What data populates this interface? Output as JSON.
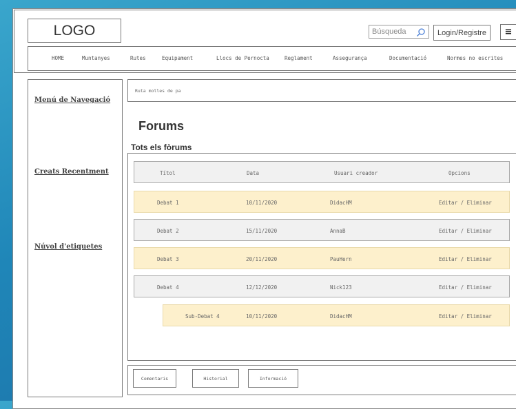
{
  "header": {
    "logo": "LOGO",
    "search_placeholder": "Búsqueda",
    "login_label": "Login/Registre",
    "menu_label": "≡"
  },
  "nav": {
    "items": [
      "HOME",
      "Muntanyes",
      "Rutes",
      "Equipament",
      "Llocs de Pernocta",
      "Reglament",
      "Assegurança",
      "Documentació",
      "Normes no escrites"
    ]
  },
  "sidebar": {
    "items": [
      "Menú de Navegació",
      "Creats Recentment",
      "Núvol d'etiquetes"
    ]
  },
  "breadcrumb": "Ruta molles de pa",
  "page": {
    "title": "Forums",
    "subtitle": "Tots els fòrums"
  },
  "table": {
    "headers": [
      "Títol",
      "Data",
      "Usuari creador",
      "Opcions"
    ],
    "rows": [
      {
        "title": "Debat 1",
        "date": "10/11/2020",
        "user": "DidacHM",
        "options": "Editar / Eliminar"
      },
      {
        "title": "Debat 2",
        "date": "15/11/2020",
        "user": "AnnaB",
        "options": "Editar / Eliminar"
      },
      {
        "title": "Debat 3",
        "date": "20/11/2020",
        "user": "PauHern",
        "options": "Editar / Eliminar"
      },
      {
        "title": "Debat 4",
        "date": "12/12/2020",
        "user": "Nick123",
        "options": "Editar / Eliminar"
      },
      {
        "title": "Sub-Debat 4",
        "date": "10/11/2020",
        "user": "DidacHM",
        "options": "Editar / Eliminar"
      }
    ]
  },
  "bottom_tabs": [
    "Comentaris",
    "Historial",
    "Informació"
  ],
  "colors": {
    "background": "#1f86b8",
    "row_gray": "#f1f1f1",
    "row_yellow": "#fdf0cc",
    "search_icon": "#4a7fd6"
  }
}
